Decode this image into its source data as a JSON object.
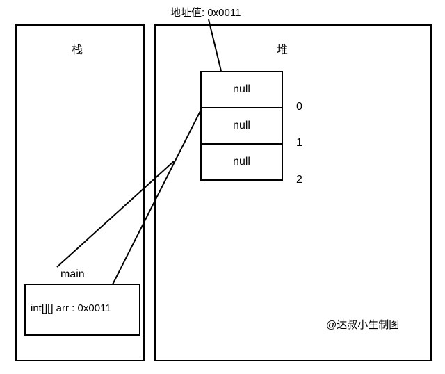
{
  "stack": {
    "title": "栈",
    "frame_label": "main",
    "var_decl": "int[][] arr : 0x0011"
  },
  "heap": {
    "title": "堆",
    "address_label": "地址值: 0x0011",
    "cells": [
      {
        "value": "null",
        "index": "0"
      },
      {
        "value": "null",
        "index": "1"
      },
      {
        "value": "null",
        "index": "2"
      }
    ]
  },
  "credit": "@达叔小生制图"
}
